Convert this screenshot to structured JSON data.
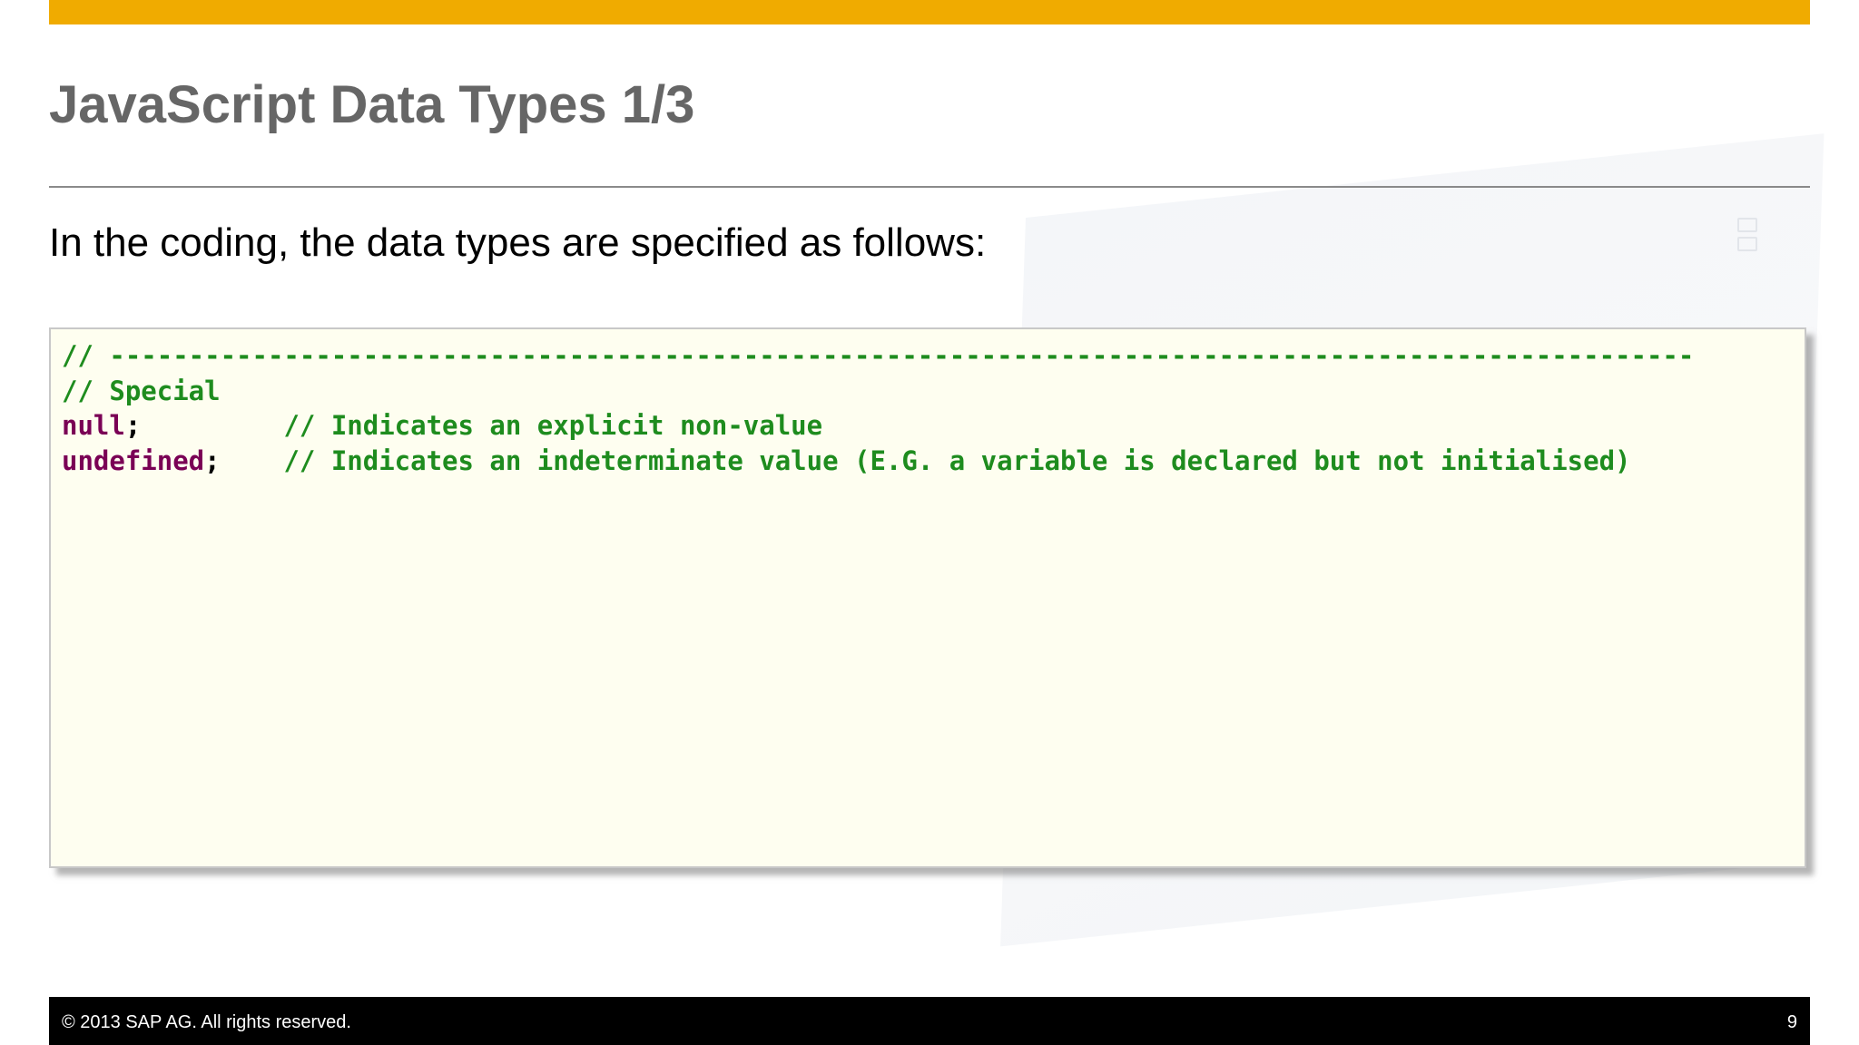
{
  "slide": {
    "title": "JavaScript Data Types 1/3",
    "intro": "In the coding, the data types are specified as follows:"
  },
  "code": {
    "lines": [
      {
        "tokens": [
          {
            "text": "// ----------------------------------------------------------------------------------------------------",
            "kind": "comment"
          }
        ]
      },
      {
        "tokens": [
          {
            "text": "// Special",
            "kind": "comment"
          }
        ]
      },
      {
        "tokens": [
          {
            "text": "null",
            "kind": "keyword"
          },
          {
            "text": ";         ",
            "kind": "plain"
          },
          {
            "text": "// Indicates an explicit non-value",
            "kind": "comment"
          }
        ]
      },
      {
        "tokens": [
          {
            "text": "undefined",
            "kind": "keyword"
          },
          {
            "text": ";    ",
            "kind": "plain"
          },
          {
            "text": "// Indicates an indeterminate value (E.G. a variable is declared but not initialised)",
            "kind": "comment"
          }
        ]
      }
    ]
  },
  "footer": {
    "copyright": "© 2013 SAP AG. All rights reserved.",
    "page_number": "9"
  },
  "colors": {
    "accent_bar": "#f0ab00",
    "title_text": "#666666",
    "code_background": "#fefef0",
    "comment": "#1e8c1e",
    "keyword": "#7a0055",
    "footer_background": "#000000"
  }
}
